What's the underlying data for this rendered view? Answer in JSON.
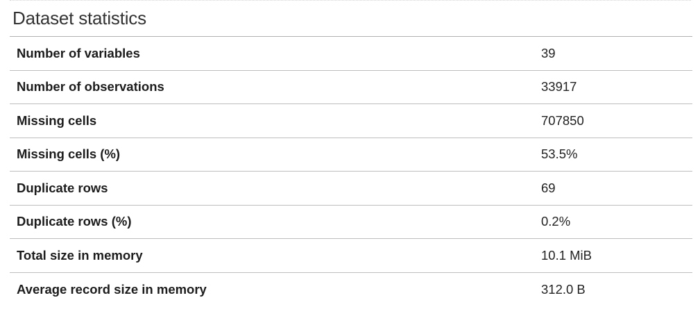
{
  "title": "Dataset statistics",
  "rows": [
    {
      "label": "Number of variables",
      "value": "39"
    },
    {
      "label": "Number of observations",
      "value": "33917"
    },
    {
      "label": "Missing cells",
      "value": "707850"
    },
    {
      "label": "Missing cells (%)",
      "value": "53.5%"
    },
    {
      "label": "Duplicate rows",
      "value": "69"
    },
    {
      "label": "Duplicate rows (%)",
      "value": "0.2%"
    },
    {
      "label": "Total size in memory",
      "value": "10.1 MiB"
    },
    {
      "label": "Average record size in memory",
      "value": "312.0 B"
    }
  ]
}
